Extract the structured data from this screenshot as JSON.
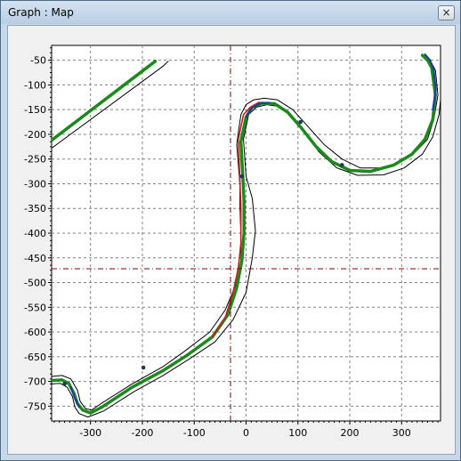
{
  "window": {
    "title": "Graph : Map",
    "close_label": "×"
  },
  "chart_data": {
    "type": "line",
    "title": "",
    "xlabel": "",
    "ylabel": "",
    "xlim": [
      -375,
      375
    ],
    "ylim": [
      -780,
      -20
    ],
    "grid": true,
    "x_ticks": [
      -300,
      -200,
      -100,
      0,
      100,
      200,
      300
    ],
    "y_ticks": [
      -50,
      -100,
      -150,
      -200,
      -250,
      -300,
      -350,
      -400,
      -450,
      -500,
      -550,
      -600,
      -650,
      -700,
      -750
    ],
    "crosshair": {
      "x": -30,
      "y": -472
    },
    "colors": {
      "track_edge": "#000000",
      "driven_line": "#1a8a1a",
      "driven_line_alt": "#1a3aa8",
      "driven_line_braking": "#c82020",
      "crosshair": "#8b0000",
      "grid": "#808080"
    },
    "series": [
      {
        "role": "track_outer_edge",
        "points": [
          [
            -375,
            -228
          ],
          [
            -160,
            -62
          ],
          [
            -150,
            -52
          ]
        ]
      },
      {
        "role": "track_inner_edge",
        "points": [
          [
            -375,
            -212
          ],
          [
            -175,
            -52
          ]
        ]
      },
      {
        "role": "driven_line",
        "points": [
          [
            -375,
            -212
          ],
          [
            -175,
            -52
          ]
        ]
      },
      {
        "role": "track_left_edge",
        "points": [
          [
            -375,
            -690
          ],
          [
            -355,
            -688
          ],
          [
            -338,
            -695
          ],
          [
            -325,
            -718
          ],
          [
            -320,
            -740
          ],
          [
            -310,
            -755
          ],
          [
            -298,
            -758
          ],
          [
            -280,
            -745
          ],
          [
            -220,
            -705
          ],
          [
            -160,
            -670
          ],
          [
            -120,
            -640
          ],
          [
            -70,
            -600
          ],
          [
            -40,
            -555
          ],
          [
            -20,
            -505
          ],
          [
            -10,
            -460
          ],
          [
            -10,
            -405
          ],
          [
            -12,
            -340
          ],
          [
            -12,
            -300
          ],
          [
            -18,
            -220
          ],
          [
            -10,
            -160
          ],
          [
            0,
            -140
          ],
          [
            15,
            -130
          ],
          [
            35,
            -127
          ],
          [
            60,
            -130
          ],
          [
            90,
            -150
          ],
          [
            120,
            -185
          ],
          [
            150,
            -220
          ],
          [
            185,
            -250
          ],
          [
            220,
            -268
          ],
          [
            265,
            -268
          ],
          [
            300,
            -255
          ],
          [
            330,
            -232
          ],
          [
            350,
            -210
          ],
          [
            362,
            -170
          ],
          [
            370,
            -120
          ],
          [
            365,
            -70
          ],
          [
            355,
            -50
          ],
          [
            345,
            -40
          ]
        ]
      },
      {
        "role": "track_right_edge",
        "points": [
          [
            -375,
            -705
          ],
          [
            -358,
            -704
          ],
          [
            -345,
            -712
          ],
          [
            -335,
            -730
          ],
          [
            -330,
            -752
          ],
          [
            -322,
            -765
          ],
          [
            -305,
            -772
          ],
          [
            -275,
            -760
          ],
          [
            -215,
            -720
          ],
          [
            -160,
            -688
          ],
          [
            -110,
            -655
          ],
          [
            -60,
            -620
          ],
          [
            -25,
            -575
          ],
          [
            0,
            -520
          ],
          [
            12,
            -450
          ],
          [
            18,
            -395
          ],
          [
            12,
            -330
          ],
          [
            0,
            -285
          ],
          [
            -5,
            -210
          ],
          [
            5,
            -160
          ],
          [
            20,
            -145
          ],
          [
            40,
            -140
          ],
          [
            60,
            -143
          ],
          [
            85,
            -160
          ],
          [
            110,
            -190
          ],
          [
            140,
            -235
          ],
          [
            175,
            -268
          ],
          [
            215,
            -283
          ],
          [
            265,
            -282
          ],
          [
            305,
            -268
          ],
          [
            340,
            -240
          ],
          [
            360,
            -205
          ],
          [
            372,
            -160
          ],
          [
            375,
            -130
          ]
        ]
      },
      {
        "role": "driven_line_main",
        "points": [
          [
            -375,
            -698
          ],
          [
            -355,
            -697
          ],
          [
            -342,
            -704
          ],
          [
            -332,
            -724
          ],
          [
            -325,
            -745
          ],
          [
            -315,
            -758
          ],
          [
            -300,
            -764
          ],
          [
            -278,
            -752
          ],
          [
            -220,
            -712
          ],
          [
            -160,
            -678
          ],
          [
            -115,
            -648
          ],
          [
            -65,
            -610
          ],
          [
            -35,
            -565
          ],
          [
            -18,
            -510
          ],
          [
            -8,
            -455
          ],
          [
            -4,
            -400
          ],
          [
            -4,
            -335
          ],
          [
            -6,
            -290
          ],
          [
            -10,
            -215
          ],
          [
            0,
            -165
          ],
          [
            12,
            -145
          ],
          [
            30,
            -137
          ],
          [
            55,
            -138
          ],
          [
            80,
            -155
          ],
          [
            105,
            -185
          ],
          [
            135,
            -225
          ],
          [
            165,
            -255
          ],
          [
            200,
            -273
          ],
          [
            240,
            -275
          ],
          [
            285,
            -262
          ],
          [
            320,
            -240
          ],
          [
            345,
            -210
          ],
          [
            360,
            -170
          ],
          [
            365,
            -120
          ],
          [
            358,
            -65
          ],
          [
            350,
            -50
          ],
          [
            340,
            -40
          ]
        ]
      },
      {
        "role": "driven_line_braking",
        "points": [
          [
            -65,
            -610
          ],
          [
            -40,
            -570
          ],
          [
            -25,
            -520
          ],
          [
            -15,
            -470
          ],
          [
            -10,
            -420
          ],
          [
            -10,
            -350
          ],
          [
            -12,
            -290
          ],
          [
            -15,
            -210
          ],
          [
            -5,
            -160
          ],
          [
            8,
            -145
          ],
          [
            25,
            -135
          ]
        ]
      },
      {
        "role": "driven_line_alt",
        "points": [
          [
            360,
            -150
          ],
          [
            366,
            -110
          ],
          [
            362,
            -70
          ],
          [
            355,
            -50
          ],
          [
            345,
            -38
          ]
        ]
      },
      {
        "role": "driven_line_alt",
        "points": [
          [
            0,
            -165
          ],
          [
            10,
            -148
          ],
          [
            25,
            -138
          ],
          [
            45,
            -136
          ]
        ]
      },
      {
        "role": "driven_line_alt",
        "points": [
          [
            -338,
            -712
          ],
          [
            -330,
            -735
          ],
          [
            -322,
            -752
          ]
        ]
      }
    ],
    "markers": [
      [
        -198,
        -672
      ],
      [
        -350,
        -705
      ],
      [
        -8,
        -285
      ],
      [
        105,
        -175
      ],
      [
        185,
        -262
      ]
    ]
  }
}
